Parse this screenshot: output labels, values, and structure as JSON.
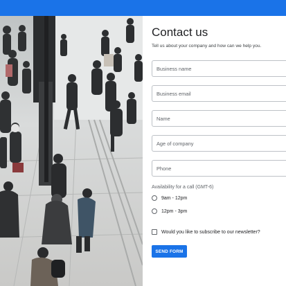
{
  "header": {
    "bar_color": "#1a73e8"
  },
  "photo": {
    "description_icon": "crowd-photo"
  },
  "form": {
    "title": "Contact us",
    "subtitle": "Tell us about your company and how can we help you.",
    "fields": {
      "business_name": {
        "placeholder": "Business name",
        "value": ""
      },
      "business_email": {
        "placeholder": "Business email",
        "value": ""
      },
      "name": {
        "placeholder": "Name",
        "value": ""
      },
      "age_of_company": {
        "placeholder": "Age of company",
        "value": ""
      },
      "phone": {
        "placeholder": "Phone",
        "value": ""
      }
    },
    "availability": {
      "label": "Availability for a call (GMT-6)",
      "options": [
        {
          "label": "9am - 12pm",
          "selected": false
        },
        {
          "label": "12pm - 3pm",
          "selected": false
        }
      ]
    },
    "newsletter": {
      "label": "Would you like to subscribe to our newsletter?",
      "checked": false
    },
    "submit_label": "SEND FORM",
    "accent_color": "#1a73e8"
  }
}
